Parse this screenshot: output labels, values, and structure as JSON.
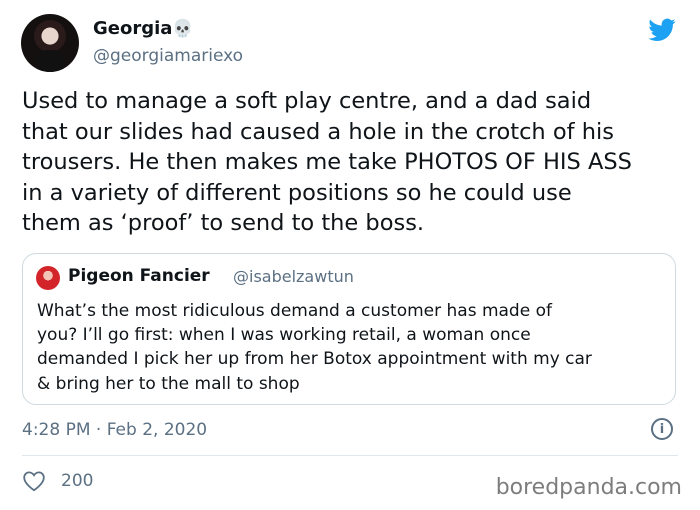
{
  "author": {
    "name": "Georgia",
    "emoji": "💀",
    "handle": "@georgiamariexo"
  },
  "tweet": {
    "text": "Used to manage a soft play centre, and a dad said\nthat our slides had caused a hole in the crotch of his\ntrousers. He then makes me take PHOTOS OF HIS ASS\nin a variety of different positions so he could use\nthem as ‘proof’ to send to the boss."
  },
  "quoted_tweet": {
    "name": "Pigeon Fancier",
    "handle": "@isabelzawtun",
    "text": "What’s the most ridiculous demand a customer has made of\nyou? I’ll go first: when I was working retail, a woman once\ndemanded I pick her up from her Botox appointment with my car\n& bring her to the mall to shop"
  },
  "meta": {
    "timestamp": "4:28 PM · Feb 2, 2020",
    "likes": "200"
  },
  "icons": {
    "brand": "twitter-bird-icon",
    "info": "info-icon",
    "like": "heart-icon"
  },
  "colors": {
    "brand": "#1da1f2",
    "secondary_text": "#5b7083"
  },
  "watermark": "boredpanda.com"
}
